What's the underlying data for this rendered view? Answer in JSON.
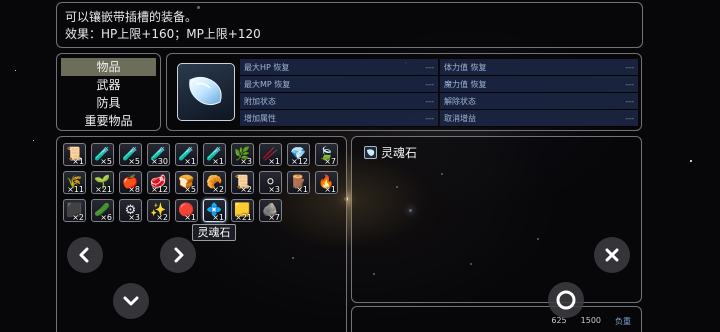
{
  "description": {
    "line1": "可以镶嵌带插槽的装备。",
    "line2": "效果：HP上限+160；MP上限+120"
  },
  "categories": [
    {
      "label": "物品",
      "selected": true
    },
    {
      "label": "武器",
      "selected": false
    },
    {
      "label": "防具",
      "selected": false
    },
    {
      "label": "重要物品",
      "selected": false
    }
  ],
  "stats": [
    [
      {
        "label": "最大HP 恢复",
        "value": "---"
      },
      {
        "label": "体力值 恢复",
        "value": "---"
      }
    ],
    [
      {
        "label": "最大MP 恢复",
        "value": "---"
      },
      {
        "label": "魔力值 恢复",
        "value": "---"
      }
    ],
    [
      {
        "label": "附加状态",
        "value": "---"
      },
      {
        "label": "解除状态",
        "value": "---"
      }
    ],
    [
      {
        "label": "增加属性",
        "value": "---"
      },
      {
        "label": "取消增益",
        "value": "---"
      }
    ]
  ],
  "inventory": [
    {
      "icon": "scroll-icon",
      "glyph": "📜",
      "count": "×1"
    },
    {
      "icon": "red-potion-icon",
      "glyph": "🧪",
      "count": "×5"
    },
    {
      "icon": "pink-potion-icon",
      "glyph": "🧪",
      "count": "×5"
    },
    {
      "icon": "blue-potion-icon",
      "glyph": "🧪",
      "count": "×30"
    },
    {
      "icon": "mana-potion-icon",
      "glyph": "🧪",
      "count": "×1"
    },
    {
      "icon": "green-potion-icon",
      "glyph": "🧪",
      "count": "×1"
    },
    {
      "icon": "herb-icon",
      "glyph": "🌿",
      "count": "×3"
    },
    {
      "icon": "staff-icon",
      "glyph": "🥢",
      "count": "×1"
    },
    {
      "icon": "crystal-icon",
      "glyph": "💎",
      "count": "×12"
    },
    {
      "icon": "leaf-icon",
      "glyph": "🍃",
      "count": "×7"
    },
    {
      "icon": "grass-icon",
      "glyph": "🌾",
      "count": "×11"
    },
    {
      "icon": "plant-icon",
      "glyph": "🌱",
      "count": "×21"
    },
    {
      "icon": "apple-icon",
      "glyph": "🍎",
      "count": "×8"
    },
    {
      "icon": "meat-icon",
      "glyph": "🥩",
      "count": "×12"
    },
    {
      "icon": "bread-icon",
      "glyph": "🍞",
      "count": "×5"
    },
    {
      "icon": "pastry-icon",
      "glyph": "🥐",
      "count": "×2"
    },
    {
      "icon": "scroll-roll-icon",
      "glyph": "📜",
      "count": "×2"
    },
    {
      "icon": "orb-icon",
      "glyph": "⚪",
      "count": "×3"
    },
    {
      "icon": "wood-icon",
      "glyph": "🪵",
      "count": "×1"
    },
    {
      "icon": "torch-icon",
      "glyph": "🔥",
      "count": "×1"
    },
    {
      "icon": "ore-icon",
      "glyph": "⬛",
      "count": "×2"
    },
    {
      "icon": "jade-icon",
      "glyph": "🥒",
      "count": "×6"
    },
    {
      "icon": "silver-ore-icon",
      "glyph": "⚙",
      "count": "×3"
    },
    {
      "icon": "gold-ore-icon",
      "glyph": "✨",
      "count": "×2"
    },
    {
      "icon": "ruby-icon",
      "glyph": "🔴",
      "count": "×1"
    },
    {
      "icon": "soul-stone-icon",
      "glyph": "💠",
      "count": "×1"
    },
    {
      "icon": "gold-bar-icon",
      "glyph": "🟨",
      "count": "×21"
    },
    {
      "icon": "dark-shard-icon",
      "glyph": "🪨",
      "count": "×7"
    }
  ],
  "tooltip": "灵魂石",
  "detail": {
    "item_name": "灵魂石"
  },
  "footer": {
    "val1": "625",
    "val2": "1500",
    "load_label": "负重"
  }
}
